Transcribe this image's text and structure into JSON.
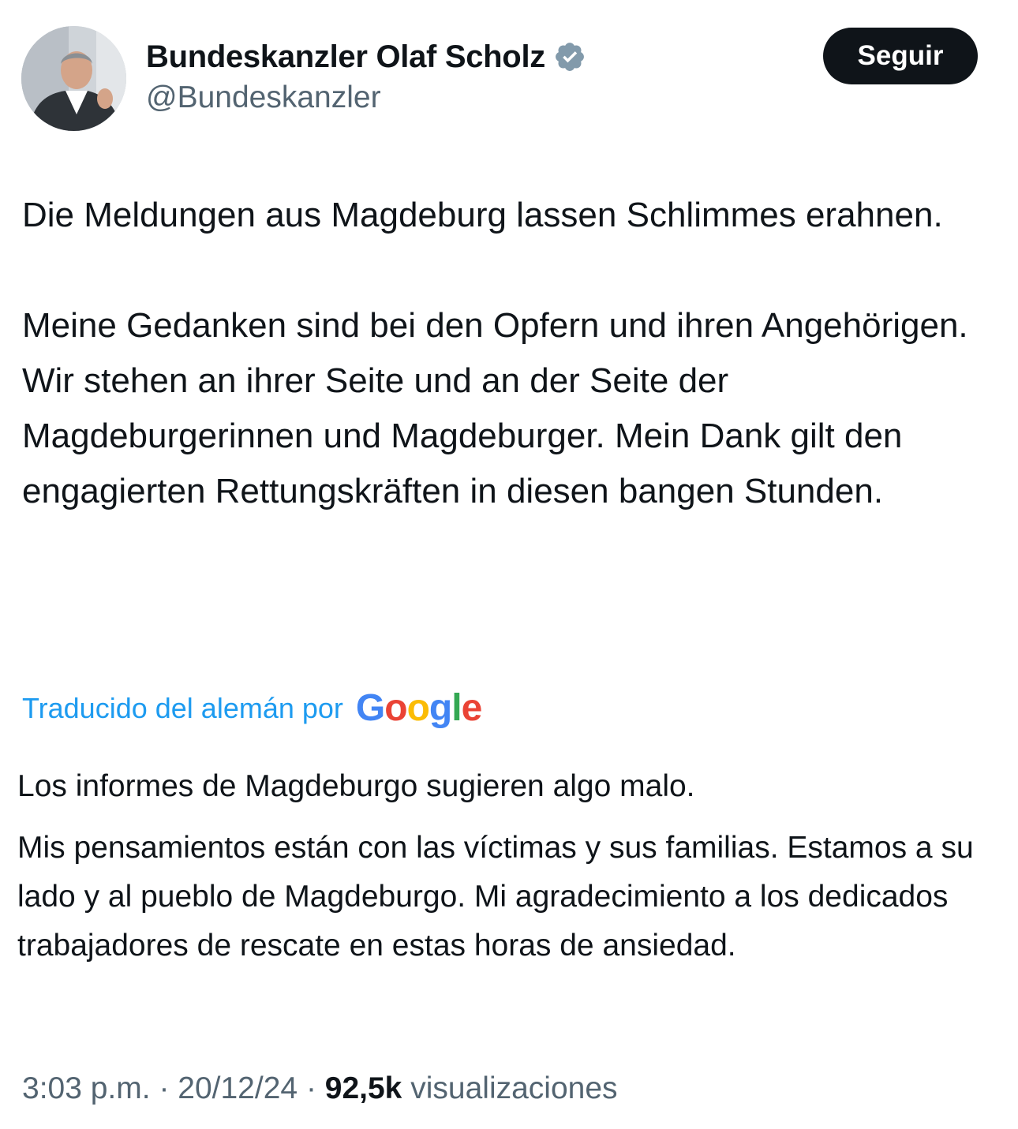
{
  "author": {
    "display_name": "Bundeskanzler Olaf Scholz",
    "handle": "@Bundeskanzler",
    "verified_icon": "verified-badge-icon",
    "verified_color": "#829aab"
  },
  "follow_button": {
    "label": "Seguir"
  },
  "tweet": {
    "original_paragraphs": [
      "Die Meldungen aus Magdeburg lassen Schlimmes erahnen.",
      "Meine Gedanken sind bei den Opfern und ihren Angehörigen. Wir stehen an ihrer Seite und an der Seite der Magdeburgerinnen und Magdeburger. Mein Dank gilt den engagierten Rettungskräften in diesen bangen Stunden."
    ],
    "translated_by_label": "Traducido del alemán por",
    "translation_provider": "Google",
    "translation_paragraphs": [
      "Los informes de Magdeburgo sugieren algo malo.",
      "Mis pensamientos están con las víctimas y sus familias. Estamos a su lado y al pueblo de Magdeburgo. Mi agradecimiento a los dedicados trabajadores de rescate en estas horas de ansiedad."
    ]
  },
  "meta": {
    "time": "3:03 p.m.",
    "separator": "·",
    "date": "20/12/24",
    "views_count": "92,5k",
    "views_label": "visualizaciones"
  },
  "colors": {
    "text_primary": "#0f1419",
    "text_secondary": "#536471",
    "link_blue": "#1d9bf0",
    "button_bg": "#0f1419",
    "google_blue": "#4285f4",
    "google_red": "#ea4335",
    "google_yellow": "#fbbc05",
    "google_green": "#34a853"
  }
}
